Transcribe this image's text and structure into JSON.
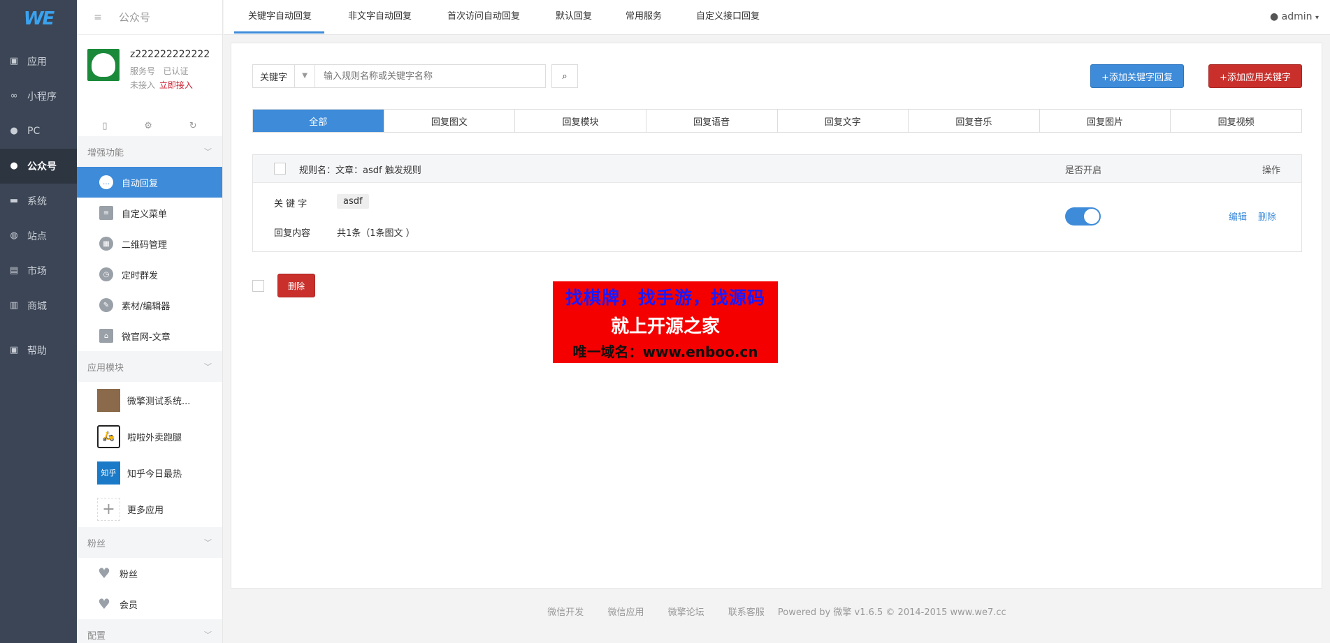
{
  "logo": "WE",
  "nav": [
    {
      "label": "应用",
      "icon": "cube-icon"
    },
    {
      "label": "小程序",
      "icon": "link-icon"
    },
    {
      "label": "PC",
      "icon": "user-icon"
    },
    {
      "label": "公众号",
      "icon": "user-icon"
    },
    {
      "label": "系统",
      "icon": "monitor-icon"
    },
    {
      "label": "站点",
      "icon": "globe-icon"
    },
    {
      "label": "市场",
      "icon": "bag-icon"
    },
    {
      "label": "商城",
      "icon": "store-icon"
    },
    {
      "label": "帮助",
      "icon": "help-icon"
    }
  ],
  "sidebar": {
    "title": "公众号",
    "account": {
      "name": "z222222222222",
      "type": "服务号",
      "verified": "已认证",
      "status": "未接入",
      "connect_link": "立即接入"
    },
    "groups": [
      {
        "title": "增强功能",
        "items": [
          "自动回复",
          "自定义菜单",
          "二维码管理",
          "定时群发",
          "素材/编辑器",
          "微官网-文章"
        ]
      },
      {
        "title": "应用模块",
        "items": [
          "微擎测试系统...",
          "啦啦外卖跑腿",
          "知乎今日最热",
          "更多应用"
        ]
      },
      {
        "title": "粉丝",
        "items": [
          "粉丝",
          "会员"
        ]
      },
      {
        "title": "配置",
        "items": []
      }
    ],
    "app_icon_texts": [
      "",
      "",
      "知乎",
      ""
    ]
  },
  "top_tabs": [
    "关键字自动回复",
    "非文字自动回复",
    "首次访问自动回复",
    "默认回复",
    "常用服务",
    "自定义接口回复"
  ],
  "user": "admin",
  "search": {
    "select_value": "关键字",
    "placeholder": "输入规则名称或关键字名称"
  },
  "buttons": {
    "add_keyword": "+添加关键字回复",
    "add_app_keyword": "+添加应用关键字",
    "delete": "删除"
  },
  "filter_tabs": [
    "全部",
    "回复图文",
    "回复模块",
    "回复语音",
    "回复文字",
    "回复音乐",
    "回复图片",
    "回复视频"
  ],
  "rule": {
    "title": "规则名：文章：asdf 触发规则",
    "enabled_label": "是否开启",
    "actions_label": "操作",
    "keyword_label": "关 键 字",
    "keyword": "asdf",
    "content_label": "回复内容",
    "content": "共1条（1条图文 ）",
    "enabled": true,
    "edit": "编辑",
    "delete": "删除"
  },
  "banner": {
    "line1": "找棋牌，找手游，找源码",
    "line2": "就上开源之家",
    "line3": "唯一域名：www.enboo.cn"
  },
  "footer": [
    "微信开发",
    "微信应用",
    "微擎论坛",
    "联系客服",
    "Powered by 微擎 v1.6.5 © 2014-2015 www.we7.cc"
  ],
  "colors": {
    "accent": "#3d8bd9",
    "danger": "#c9302c",
    "nav_bg": "#3b4555"
  }
}
